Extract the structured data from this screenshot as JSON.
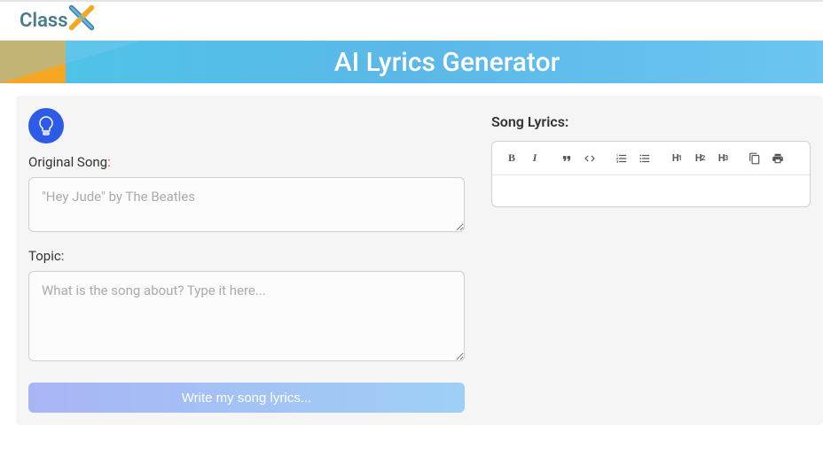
{
  "logo": {
    "text": "Class"
  },
  "banner": {
    "title": "AI Lyrics Generator"
  },
  "form": {
    "original_song_label": "Original Song",
    "original_song_placeholder": "\"Hey Jude\" by The Beatles",
    "topic_label": "Topic",
    "topic_placeholder": "What is the song about? Type it here...",
    "generate_button": "Write my song lyrics..."
  },
  "output": {
    "label": "Song Lyrics:"
  },
  "toolbar": {
    "bold": "B",
    "italic": "I",
    "h1": "H",
    "h1_sub": "1",
    "h2": "H",
    "h2_sub": "2",
    "h3": "H",
    "h3_sub": "3"
  }
}
